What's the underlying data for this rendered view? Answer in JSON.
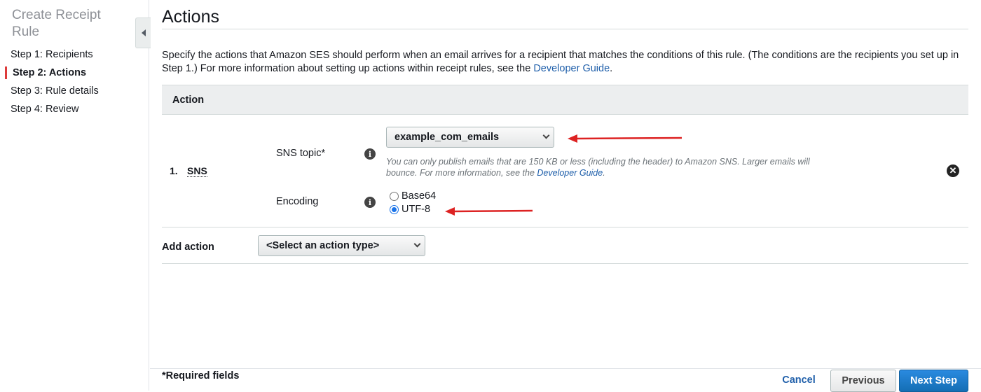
{
  "sidebar": {
    "title": "Create Receipt Rule",
    "steps": [
      {
        "label": "Step 1: Recipients"
      },
      {
        "label": "Step 2: Actions"
      },
      {
        "label": "Step 3: Rule details"
      },
      {
        "label": "Step 4: Review"
      }
    ],
    "active_step": 2
  },
  "main": {
    "title": "Actions",
    "intro_text": "Specify the actions that Amazon SES should perform when an email arrives for a recipient that matches the conditions of this rule. (The conditions are the recipients you set up in Step 1.) For more information about setting up actions within receipt rules, see the ",
    "intro_link": "Developer Guide",
    "intro_end": "."
  },
  "action_table": {
    "header": "Action",
    "rows": [
      {
        "number": "1.",
        "name": "SNS",
        "sns_topic_label": "SNS topic*",
        "sns_topic_value": "example_com_emails",
        "hint_text": "You can only publish emails that are 150 KB or less (including the header) to Amazon SNS. Larger emails will bounce. For more information, see the ",
        "hint_link": "Developer Guide",
        "hint_end": ".",
        "encoding_label": "Encoding",
        "encoding_options": [
          "Base64",
          "UTF-8"
        ],
        "encoding_selected": "UTF-8"
      }
    ]
  },
  "add_action": {
    "label": "Add action",
    "select_value": "<Select an action type>"
  },
  "footer": {
    "required_note": "*Required fields",
    "cancel_label": "Cancel",
    "previous_label": "Previous",
    "next_label": "Next Step"
  },
  "colors": {
    "accent_red": "#dd3b3b",
    "link_blue": "#1f5faa",
    "primary_blue": "#146eb4",
    "annotation_arrow": "#dd2222"
  },
  "icons": {
    "collapse": "caret-left-icon",
    "info": "info-icon",
    "remove": "close-circle-icon",
    "dropdown": "chevron-down-icon"
  }
}
